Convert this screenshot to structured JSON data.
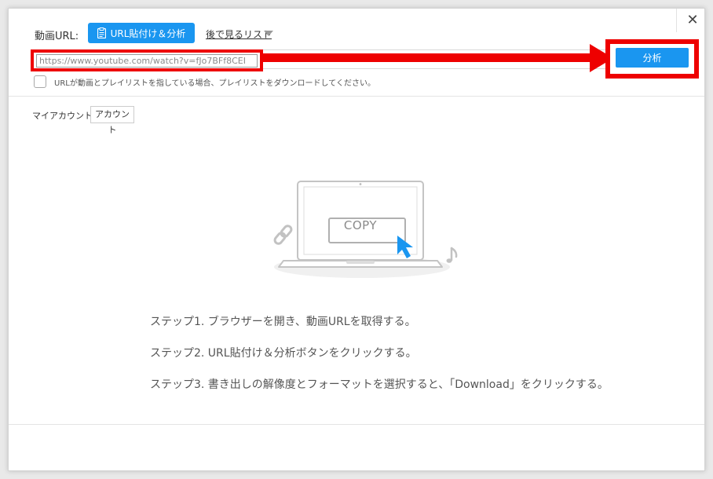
{
  "dialog": {
    "close_glyph": "✕"
  },
  "url_bar": {
    "label": "動画URL:",
    "paste_button_label": "URL貼付け＆分析",
    "watch_later_label": "後で見るリスト",
    "input_value": "https://www.youtube.com/watch?v=fJo7BFf8CEI",
    "analyze_button_label": "分析",
    "playlist_checkbox_checked": false,
    "playlist_label": "URLが動画とプレイリストを指している場合、プレイリストをダウンロードしてください。"
  },
  "account": {
    "my_account_label": "マイアカウント",
    "account_button_label": "アカウント"
  },
  "illustration": {
    "copy_label": "COPY",
    "icons": [
      "laptop-icon",
      "chain-link-icon",
      "music-note-icon",
      "cursor-arrow-icon"
    ]
  },
  "steps": [
    "ステップ1. ブラウザーを開き、動画URLを取得する。",
    "ステップ2. URL貼付け＆分析ボタンをクリックする。",
    "ステップ3. 書き出しの解像度とフォーマットを選択すると、「Download」をクリックする。"
  ],
  "colors": {
    "accent_blue": "#1a96f0",
    "annotation_red": "#ee0000",
    "text": "#555555"
  }
}
